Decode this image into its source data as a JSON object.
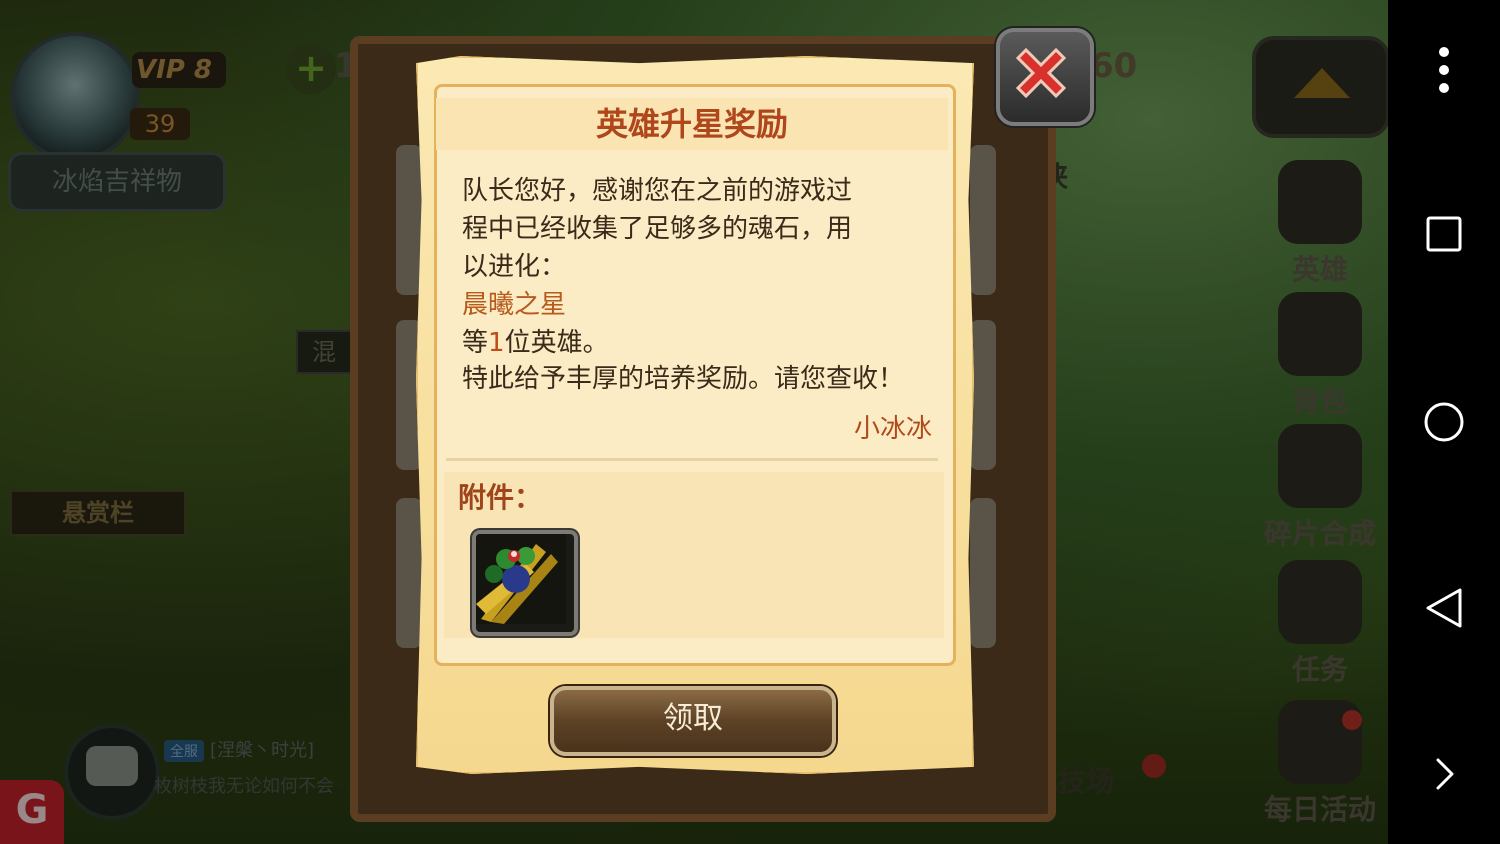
{
  "game": {
    "player": {
      "vip_label": "VIP 8",
      "level": "39",
      "mascot_label": "冰焰吉祥物"
    },
    "resource_left_partial": "1",
    "resource_right_partial": "60",
    "bounty_label": "悬赏栏",
    "hunyuan_partial": "混",
    "right_partial_label": "侠",
    "arena_partial_label": "竞技场",
    "chat": {
      "channel_tag": "全服",
      "line1": "[涅槃丶时光]",
      "line2": "枚树枝我无论如何不会"
    },
    "side_menu": [
      {
        "label": "英雄",
        "icon": "helmet-icon"
      },
      {
        "label": "背包",
        "icon": "backpack-icon"
      },
      {
        "label": "碎片合成",
        "icon": "puzzle-icon"
      },
      {
        "label": "任务",
        "icon": "scroll-quill-icon"
      },
      {
        "label": "每日活动",
        "icon": "gift-icon"
      }
    ]
  },
  "dialog": {
    "title": "英雄升星奖励",
    "body_lines": [
      "队长您好，感谢您在之前的游戏过",
      "程中已经收集了足够多的魂石，用",
      "以进化："
    ],
    "hero_name": "晨曦之星",
    "count_prefix": "等",
    "count_number": "1",
    "count_suffix": "位英雄。",
    "closing_line": "特此给予丰厚的培养奖励。请您查收！",
    "signature": "小冰冰",
    "attachment_label": "附件：",
    "attachment_item_icon": "herb-bundle-icon",
    "claim_button": "领取",
    "colors": {
      "title": "#b0461c",
      "accent": "#b75a1c",
      "parchment": "#fbe9b3"
    }
  },
  "system_nav": {
    "menu_icon": "more-vert-icon",
    "recents_icon": "square-icon",
    "home_icon": "circle-icon",
    "back_icon": "triangle-back-icon",
    "expand_icon": "chevron-right-icon"
  }
}
